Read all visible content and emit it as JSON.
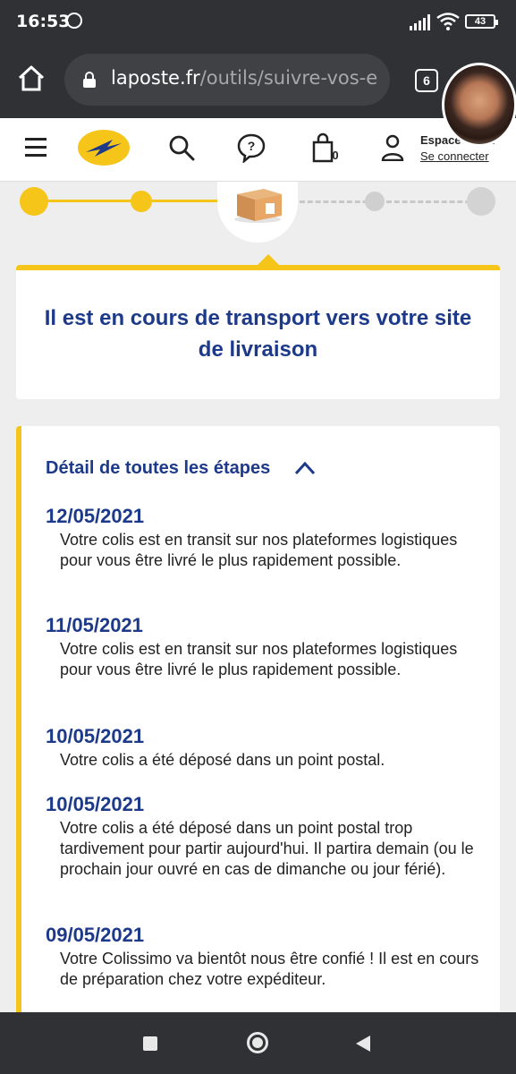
{
  "status": {
    "time": "16:53",
    "battery": "43"
  },
  "browser": {
    "url_domain": "laposte.fr",
    "url_path": "/outils/suivre-vos-e",
    "tab_count": "6"
  },
  "header": {
    "espace_label": "Espace client",
    "connect_label": "Se connecter",
    "cart_count": "0"
  },
  "status_card": {
    "title": "Il est en cours de transport vers votre site de livraison"
  },
  "details": {
    "heading": "Détail de toutes les étapes",
    "steps": [
      {
        "date": "12/05/2021",
        "text": "Votre colis est en transit sur nos plateformes logistiques pour vous être livré le plus rapidement possible."
      },
      {
        "date": "11/05/2021",
        "text": "Votre colis est en transit sur nos plateformes logistiques pour vous être livré le plus rapidement possible."
      },
      {
        "date": "10/05/2021",
        "text": "Votre colis a été déposé dans un point postal."
      },
      {
        "date": "10/05/2021",
        "text": "Votre colis a été déposé dans un point postal trop tardivement pour partir aujourd'hui. Il partira demain (ou le prochain jour ouvré en cas de dimanche ou jour férié)."
      },
      {
        "date": "09/05/2021",
        "text": "Votre Colissimo va bientôt nous être confié ! Il est en cours de préparation chez votre expéditeur."
      }
    ]
  },
  "colors": {
    "brand_yellow": "#f6c51a",
    "brand_blue": "#1d3a8a",
    "chrome_dark": "#2f3134"
  }
}
